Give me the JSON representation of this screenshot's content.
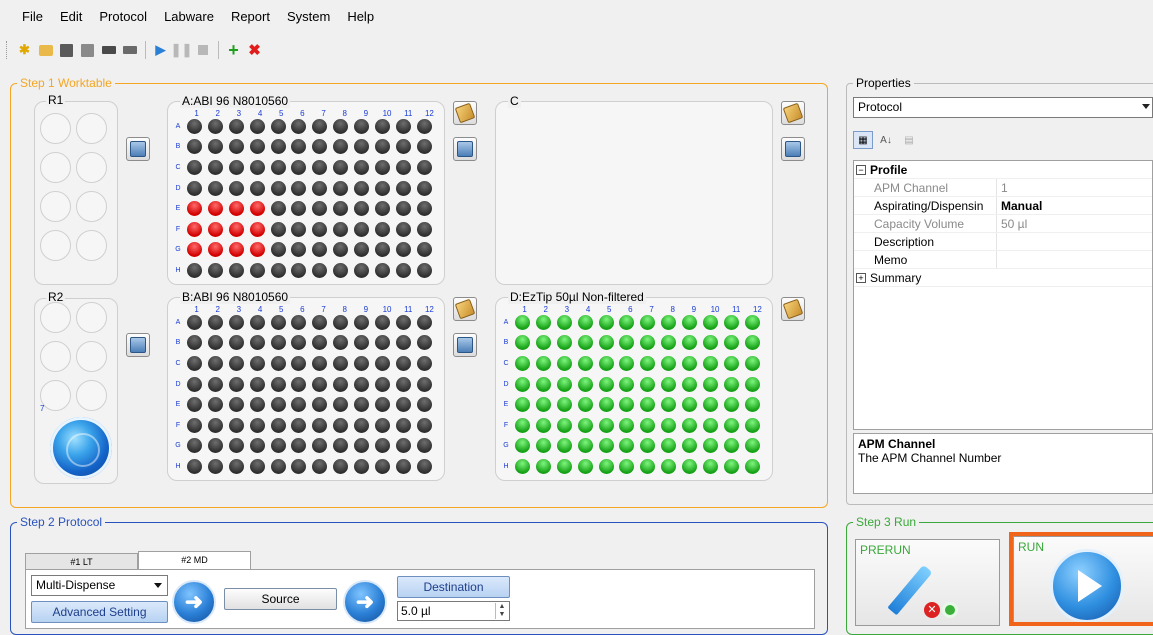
{
  "menu": [
    "File",
    "Edit",
    "Protocol",
    "Labware",
    "Report",
    "System",
    "Help"
  ],
  "toolbar_icons": [
    "new-file-icon",
    "open-folder-icon",
    "save-icon",
    "save-as-icon",
    "print-icon",
    "print-preview-icon",
    "play-icon",
    "pause-icon",
    "stop-icon",
    "add-icon",
    "delete-icon"
  ],
  "step1": {
    "title": "Step 1 Worktable",
    "racks": {
      "r1": "R1",
      "r2": "R2",
      "wash_number": "7"
    },
    "plates": {
      "a": {
        "title": "A:ABI 96 N8010560"
      },
      "b": {
        "title": "B:ABI 96 N8010560"
      },
      "c": {
        "title": "C"
      },
      "d": {
        "title": "D:EzTip 50µl Non-filtered"
      }
    },
    "columns": [
      "1",
      "2",
      "3",
      "4",
      "5",
      "6",
      "7",
      "8",
      "9",
      "10",
      "11",
      "12"
    ],
    "rows": [
      "A",
      "B",
      "C",
      "D",
      "E",
      "F",
      "G",
      "H"
    ]
  },
  "properties": {
    "title": "Properties",
    "object": "Protocol",
    "category": "Profile",
    "items": [
      {
        "key": "APM Channel",
        "value": "1"
      },
      {
        "key": "Aspirating/Dispensin",
        "value": "Manual"
      },
      {
        "key": "Capacity Volume",
        "value": "50 µl"
      },
      {
        "key": "Description",
        "value": ""
      },
      {
        "key": "Memo",
        "value": ""
      }
    ],
    "summary": "Summary",
    "desc_title": "APM Channel",
    "desc_text": "The APM Channel Number"
  },
  "step2": {
    "title": "Step 2 Protocol",
    "tabs": [
      "#1 LT",
      "#2 MD"
    ],
    "mode": "Multi-Dispense",
    "advanced": "Advanced Setting",
    "source": "Source",
    "destination": "Destination",
    "volume": "5.0 µl"
  },
  "step3": {
    "title": "Step 3 Run",
    "prerun": "PRERUN",
    "run": "RUN"
  },
  "colors": {
    "step1": "#f4a624",
    "step2": "#2a52be",
    "step3": "#3aa83a",
    "highlight": "#f0651a"
  }
}
